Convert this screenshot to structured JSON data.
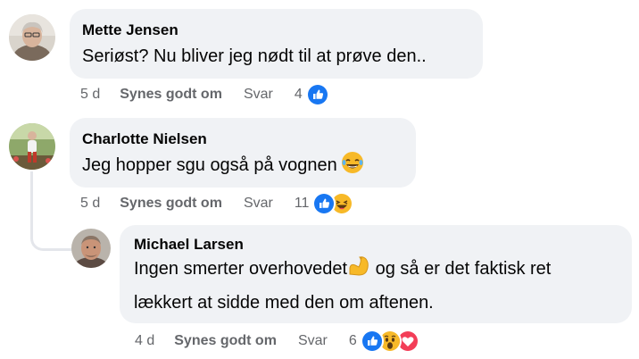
{
  "comments": [
    {
      "author": "Mette Jensen",
      "text": "Seriøst? Nu bliver jeg nødt til at prøve den..",
      "time": "5 d",
      "like_label": "Synes godt om",
      "reply_label": "Svar",
      "reaction_count": "4",
      "reactions": [
        "like"
      ]
    },
    {
      "author": "Charlotte Nielsen",
      "text": "Jeg hopper sgu også på vognen",
      "inline_emoji": "laughing-tears-emoji",
      "time": "5 d",
      "like_label": "Synes godt om",
      "reply_label": "Svar",
      "reaction_count": "11",
      "reactions": [
        "like",
        "haha"
      ]
    },
    {
      "author": "Michael Larsen",
      "text_line1": "Ingen smerter overhovedet",
      "inline_emoji": "flexed-biceps-emoji",
      "text_line1_after": " og så er det faktisk ret",
      "text_line2": "lækkert at sidde med den om aftenen.",
      "time": "4 d",
      "like_label": "Synes godt om",
      "reply_label": "Svar",
      "reaction_count": "6",
      "reactions": [
        "like",
        "wow",
        "love"
      ]
    }
  ],
  "colors": {
    "bubble": "#f0f2f5",
    "meta_text": "#65676b",
    "like_blue": "#1877f2",
    "love_red": "#f33e58",
    "emoji_yellow": "#f7b928",
    "thread_line": "#e4e6eb"
  }
}
